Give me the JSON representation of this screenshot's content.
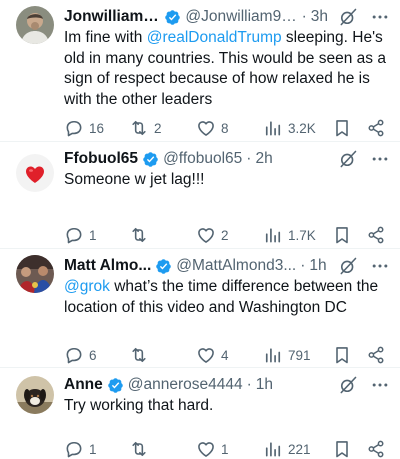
{
  "colors": {
    "accent": "#1d9bf0",
    "muted": "#536471",
    "text": "#0f1419"
  },
  "tweets": [
    {
      "name": "Jonwilliams...",
      "handle": "@Jonwilliam99...",
      "time": "3h",
      "text_before": "Im fine with ",
      "mention": "@realDonaldTrump",
      "text_after": " sleeping. He's old in many countries. This would be seen as a sign of respect because of how relaxed he is with the other leaders",
      "replies": "16",
      "reposts": "2",
      "likes": "8",
      "views": "3.2K",
      "avatar_icon": "man-photo-avatar"
    },
    {
      "name": "Ffobuol65",
      "handle": "@ffobuol65",
      "time": "2h",
      "text_before": "Someone w jet lag!!!",
      "mention": "",
      "text_after": "",
      "replies": "1",
      "reposts": "",
      "likes": "2",
      "views": "1.7K",
      "avatar_icon": "red-heart-avatar"
    },
    {
      "name": "Matt Almo...",
      "handle": "@MattAlmond3...",
      "time": "1h",
      "text_before": "",
      "mention": "@grok",
      "text_after": " what’s the time difference between the location of this video and Washington DC",
      "replies": "6",
      "reposts": "",
      "likes": "4",
      "views": "791",
      "avatar_icon": "group-photo-avatar"
    },
    {
      "name": "Anne",
      "handle": "@annerose4444",
      "time": "1h",
      "text_before": "Try working that hard.",
      "mention": "",
      "text_after": "",
      "replies": "1",
      "reposts": "",
      "likes": "1",
      "views": "221",
      "avatar_icon": "dog-photo-avatar"
    }
  ],
  "separator": "·"
}
